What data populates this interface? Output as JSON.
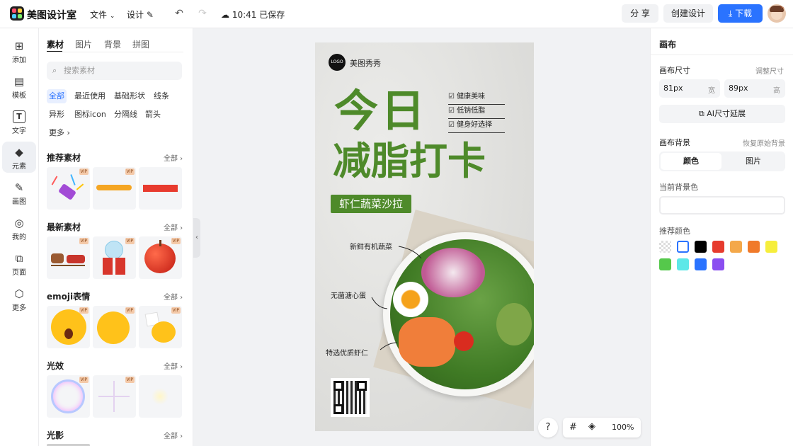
{
  "topbar": {
    "brand": "美图设计室",
    "file_menu": "文件",
    "design_menu": "设计",
    "save_status": "10:41 已保存",
    "share_label": "分 享",
    "create_label": "创建设计",
    "download_label": "下载",
    "avatar_badge": "VIP"
  },
  "leftnav": {
    "items": [
      {
        "label": "添加",
        "icon": "plus-square-icon"
      },
      {
        "label": "模板",
        "icon": "template-icon"
      },
      {
        "label": "文字",
        "icon": "text-icon"
      },
      {
        "label": "元素",
        "icon": "shapes-icon"
      },
      {
        "label": "画图",
        "icon": "draw-icon"
      },
      {
        "label": "我的",
        "icon": "user-icon"
      },
      {
        "label": "页面",
        "icon": "add-page-icon"
      },
      {
        "label": "更多",
        "icon": "cube-icon"
      }
    ],
    "active": "元素"
  },
  "panel": {
    "tabs": [
      "素材",
      "图片",
      "背景",
      "拼图"
    ],
    "active_tab": "素材",
    "search_placeholder": "搜索素材",
    "chips": [
      "全部",
      "最近使用",
      "基础形状",
      "线条",
      "异形",
      "图标icon",
      "分隔线",
      "箭头",
      "更多"
    ],
    "active_chip": "全部",
    "sections": [
      {
        "title": "推荐素材",
        "all": "全部"
      },
      {
        "title": "最新素材",
        "all": "全部"
      },
      {
        "title": "emoji表情",
        "all": "全部"
      },
      {
        "title": "光效",
        "all": "全部"
      },
      {
        "title": "光影",
        "all": "全部"
      }
    ],
    "vip_label": "VIP"
  },
  "canvas": {
    "logo_text": "LOGO",
    "brand_text": "美图秀秀",
    "headline_line1": "今日",
    "headline_line2": "减脂打卡",
    "checklist": [
      "健康美味",
      "低钠低脂",
      "健身好选择"
    ],
    "subtitle": "虾仁蔬菜沙拉",
    "callouts": [
      "新鲜有机蔬菜",
      "无菌溏心蛋",
      "特选优质虾仁"
    ]
  },
  "rightpanel": {
    "title": "画布",
    "size_label": "画布尺寸",
    "size_adjust": "调整尺寸",
    "width_value": "81px",
    "width_unit": "宽",
    "height_value": "89px",
    "height_unit": "高",
    "ai_extend": "AI尺寸延展",
    "bg_label": "画布背景",
    "bg_reset": "恢复原始背景",
    "bg_tabs": [
      "颜色",
      "图片"
    ],
    "current_bg_label": "当前背景色",
    "recommended_label": "推荐颜色",
    "colors": [
      "transparent",
      "#ffffff",
      "#000000",
      "#e63b2e",
      "#f4a84a",
      "#f07a2a",
      "#f6ee3c",
      "#55c84b",
      "#5de8e8",
      "#2a73ff",
      "#8a4ef0"
    ]
  },
  "floating": {
    "help": "?",
    "zoom": "100%"
  }
}
